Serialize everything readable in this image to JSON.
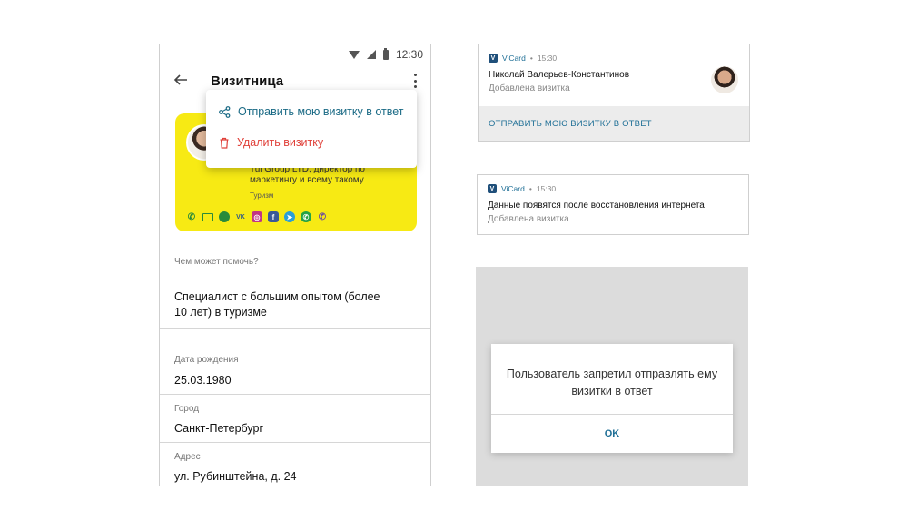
{
  "statusbar": {
    "time": "12:30"
  },
  "appbar": {
    "title": "Визитница"
  },
  "menu": {
    "share_label": "Отправить мою визитку в ответ",
    "delete_label": "Удалить визитку"
  },
  "card": {
    "company": "Tui Group LTD, директор по маркетингу и всему такому",
    "category": "Туризм",
    "contact_icons": [
      "phone-icon",
      "mail-icon",
      "globe-icon",
      "vk-icon",
      "instagram-icon",
      "facebook-icon",
      "telegram-icon",
      "whatsapp-icon",
      "viber-icon"
    ]
  },
  "profile": {
    "help_label": "Чем может помочь?",
    "help_value": "Специалист с большим опытом (более 10 лет) в туризме",
    "birth_label": "Дата рождения",
    "birth_value": "25.03.1980",
    "city_label": "Город",
    "city_value": "Санкт-Петербург",
    "address_label": "Адрес",
    "address_value": "ул. Рубинштейна, д. 24"
  },
  "notification1": {
    "app": "ViCard",
    "time": "15:30",
    "title": "Николай Валерьев-Константинов",
    "subtitle": "Добавлена визитка",
    "action": "ОТПРАВИТЬ МОЮ ВИЗИТКУ В ОТВЕТ"
  },
  "notification2": {
    "app": "ViCard",
    "time": "15:30",
    "title": "Данные появятся после восстановления интернета",
    "subtitle": "Добавлена визитка"
  },
  "dialog": {
    "message": "Пользователь запретил отправлять ему визитки в ответ",
    "ok": "OK"
  },
  "colors": {
    "card_background": "#f7ea14",
    "accent": "#1f6f96",
    "danger": "#e0413a"
  }
}
